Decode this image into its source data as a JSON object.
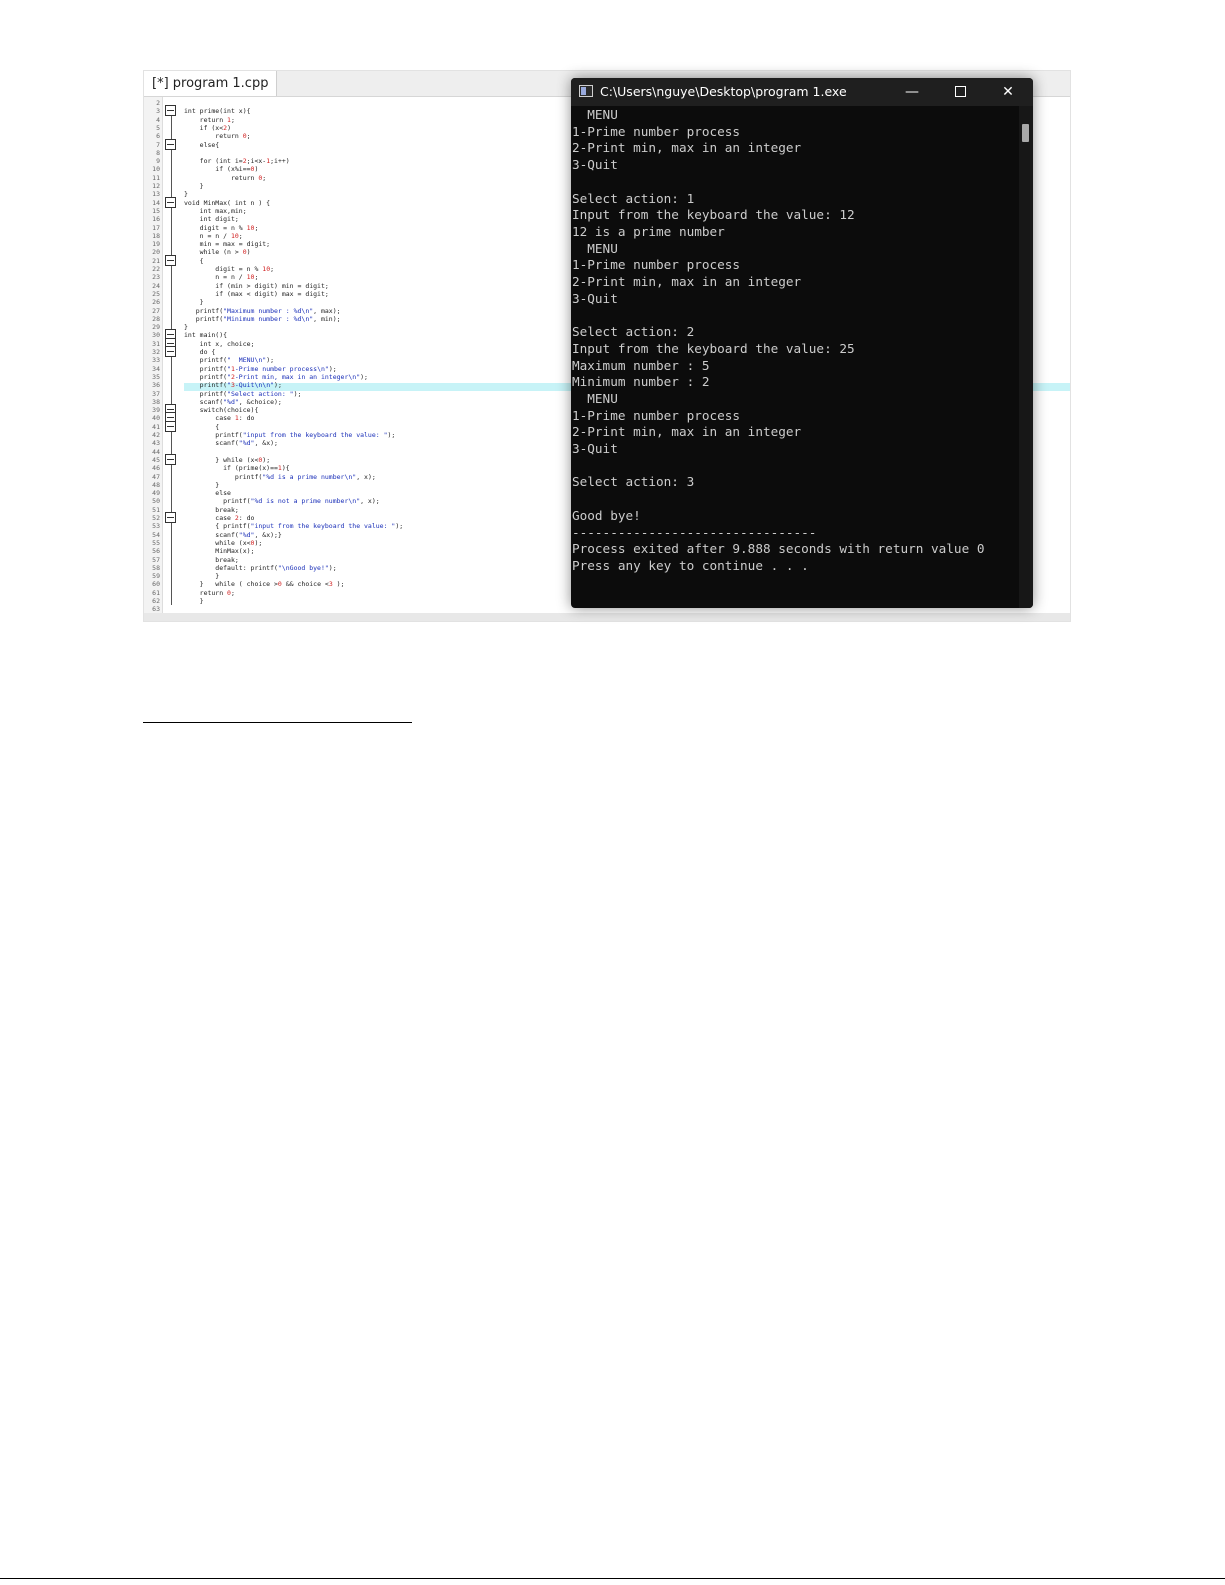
{
  "editor": {
    "tab_label": "[*] program 1.cpp",
    "line_numbers": [
      "2",
      "3",
      "4",
      "5",
      "6",
      "7",
      "8",
      "9",
      "10",
      "11",
      "12",
      "13",
      "14",
      "15",
      "16",
      "17",
      "18",
      "19",
      "20",
      "21",
      "22",
      "23",
      "24",
      "25",
      "26",
      "27",
      "28",
      "29",
      "30",
      "31",
      "32",
      "33",
      "34",
      "35",
      "36",
      "37",
      "38",
      "39",
      "40",
      "41",
      "42",
      "43",
      "44",
      "45",
      "46",
      "47",
      "48",
      "49",
      "50",
      "51",
      "52",
      "53",
      "54",
      "55",
      "56",
      "57",
      "58",
      "59",
      "60",
      "61",
      "62",
      "63"
    ],
    "code_lines": [
      "",
      "int prime(int x){",
      "    return 1;",
      "    if (x<2)",
      "        return 0;",
      "    else{",
      "",
      "    for (int i=2;i<x-1;i++)",
      "        if (x%i==0)",
      "            return 0;",
      "    }",
      "}",
      "void MinMax( int n ) {",
      "    int max,min;",
      "    int digit;",
      "    digit = n % 10;",
      "    n = n / 10;",
      "    min = max = digit;",
      "    while (n > 0)",
      "    {",
      "        digit = n % 10;",
      "        n = n / 10;",
      "        if (min > digit) min = digit;",
      "        if (max < digit) max = digit;",
      "    }",
      "   printf(\"Maximum number : %d\\n\", max);",
      "   printf(\"Minimum number : %d\\n\", min);",
      "}",
      "int main(){",
      "    int x, choice;",
      "    do {",
      "    printf(\"  MENU\\n\");",
      "    printf(\"1-Prime number process\\n\");",
      "    printf(\"2-Print min, max in an integer\\n\");",
      "    printf(\"3-Quit\\n\\n\");",
      "    printf(\"Select action: \");",
      "    scanf(\"%d\", &choice);",
      "    switch(choice){",
      "        case 1: do",
      "        {",
      "        printf(\"input from the keyboard the value: \");",
      "        scanf(\"%d\", &x);",
      "",
      "        } while (x<0);",
      "          if (prime(x)==1){",
      "             printf(\"%d is a prime number\\n\", x);",
      "        }",
      "        else",
      "          printf(\"%d is not a prime number\\n\", x);",
      "        break;",
      "        case 2: do",
      "        { printf(\"input from the keyboard the value: \");",
      "        scanf(\"%d\", &x);}",
      "        while (x<0);",
      "        MinMax(x);",
      "        break;",
      "        default: printf(\"\\nGood bye!\");",
      "        }",
      "    }   while ( choice >0 && choice <3 );",
      "    return 0;",
      "    }",
      ""
    ]
  },
  "console": {
    "title": "C:\\Users\\nguye\\Desktop\\program 1.exe",
    "minimize_glyph": "—",
    "close_glyph": "✕",
    "lines": [
      "  MENU",
      "1-Prime number process",
      "2-Print min, max in an integer",
      "3-Quit",
      "",
      "Select action: 1",
      "Input from the keyboard the value: 12",
      "12 is a prime number",
      "  MENU",
      "1-Prime number process",
      "2-Print min, max in an integer",
      "3-Quit",
      "",
      "Select action: 2",
      "Input from the keyboard the value: 25",
      "Maximum number : 5",
      "Minimum number : 2",
      "  MENU",
      "1-Prime number process",
      "2-Print min, max in an integer",
      "3-Quit",
      "",
      "Select action: 3",
      "",
      "Good bye!",
      "--------------------------------",
      "Process exited after 9.888 seconds with return value 0",
      "Press any key to continue . . ."
    ]
  },
  "colors": {
    "console_bg": "#0c0c0c",
    "console_text": "#cccccc",
    "code_keyword": "#1a1a1a",
    "code_string": "#1a2fb8",
    "code_number": "#d11f1f",
    "highlight": "#c7f3f7"
  },
  "icons": {
    "console_app": "console-window-icon",
    "fold": "fold-minus-icon"
  }
}
